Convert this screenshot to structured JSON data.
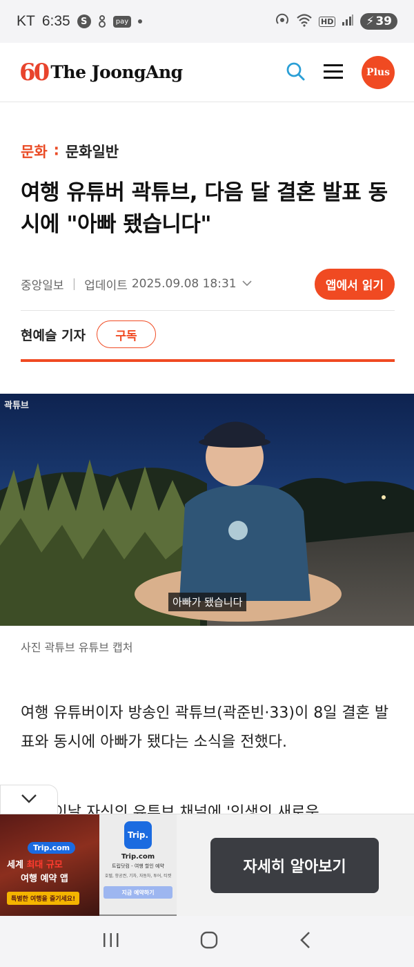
{
  "status_bar": {
    "carrier": "KT",
    "time": "6:35",
    "icons": [
      "s-app-icon",
      "location-icon",
      "pay-icon",
      "dot-icon"
    ],
    "pay_label": "pay",
    "s_label": "S",
    "right_icons": [
      "hotspot-icon",
      "wifi-icon",
      "hd-icon",
      "signal-icon"
    ],
    "hd_label": "HD",
    "battery": "39"
  },
  "header": {
    "logo_number": "60",
    "logo_text": "The JoongAng",
    "plus_label": "Plus",
    "accent_color": "#f04a22"
  },
  "breadcrumb": {
    "section": "문화",
    "separator": "∶",
    "subsection": "문화일반"
  },
  "article": {
    "headline": "여행 유튜버 곽튜브, 다음 달 결혼 발표 동시에 \"아빠 됐습니다\"",
    "source": "중앙일보",
    "updated_label": "업데이트",
    "updated_time": "2025.09.08 18:31",
    "app_button": "앱에서 읽기",
    "reporter": "현예슬 기자",
    "subscribe_button": "구독",
    "photo_watermark": "곽튜브",
    "photo_subtitle": "아빠가 됐습니다",
    "photo_caption": "사진 곽튜브 유튜브 캡처",
    "body_paragraph": "여행 유튜버이자 방송인 곽튜브(곽준빈·33)이 8일 결혼 발표와 동시에 아빠가 됐다는 소식을 전했다.",
    "body_cut_line": "그는 이날 자신의 유튜브 채널에 '인생의 새로운"
  },
  "ad": {
    "image_pill": "Trip.com",
    "image_line1_prefix": "세계 ",
    "image_line1_red": "최대 규모",
    "image_line2": "여행 예약 앱",
    "image_ribbon": "특별한 여행을 즐기세요!",
    "logo_label": "Trip.",
    "brand": "Trip.com",
    "tagline": "트립닷컴 - 여행 할인 예약",
    "categories": "호텔, 항공권, 기차, 자동차, 투어, 티켓",
    "small_cta": "지금 예약하기",
    "cta": "자세히 알아보기"
  },
  "nav_bar": {
    "icons": [
      "recent-apps-icon",
      "home-icon",
      "back-icon"
    ]
  }
}
